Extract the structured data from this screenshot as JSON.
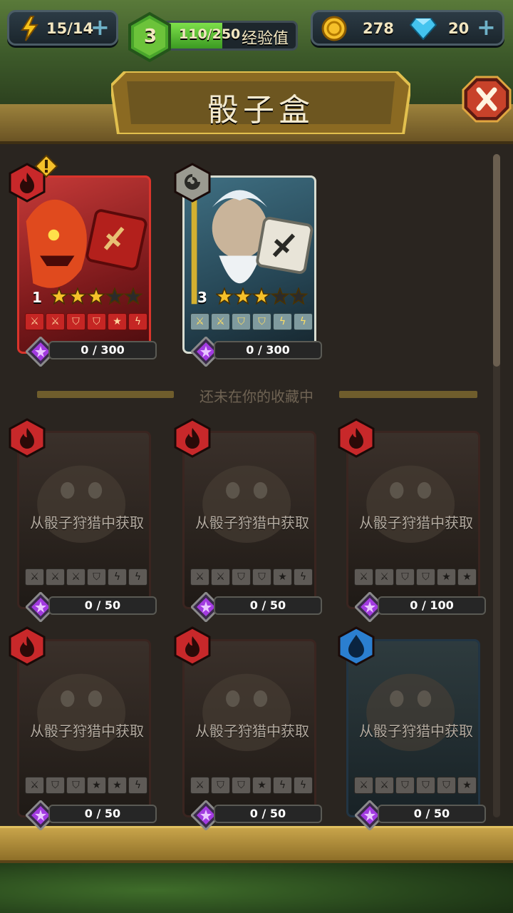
{
  "topbar": {
    "energy": "15/14",
    "level": "3",
    "xp_text": "110/250",
    "xp_label": "经验值",
    "xp_progress": 0.44,
    "coins": "278",
    "gems": "20"
  },
  "dialog": {
    "title": "骰子盒",
    "divider": "还未在你的收藏中"
  },
  "owned": [
    {
      "level": "1",
      "stars": 3,
      "progress": "0 / 300",
      "element": "fire",
      "warning": true,
      "faces": [
        "⚔",
        "⚔",
        "⛉",
        "⛉",
        "★",
        "ϟ"
      ]
    },
    {
      "level": "3",
      "stars": 3,
      "progress": "0 / 300",
      "element": "wind",
      "warning": false,
      "faces": [
        "⚔",
        "⚔",
        "⛉",
        "⛉",
        "ϟ",
        "ϟ"
      ]
    }
  ],
  "locked": [
    {
      "message": "从骰子狩猎中获取",
      "progress": "0 / 50",
      "element": "fire",
      "faces": [
        "⚔",
        "⚔",
        "⚔",
        "⛉",
        "ϟ",
        "ϟ"
      ]
    },
    {
      "message": "从骰子狩猎中获取",
      "progress": "0 / 50",
      "element": "fire",
      "faces": [
        "⚔",
        "⚔",
        "⛉",
        "⛉",
        "★",
        "ϟ"
      ]
    },
    {
      "message": "从骰子狩猎中获取",
      "progress": "0 / 100",
      "element": "fire",
      "faces": [
        "⚔",
        "⚔",
        "⛉",
        "⛉",
        "★",
        "★"
      ]
    },
    {
      "message": "从骰子狩猎中获取",
      "progress": "0 / 50",
      "element": "fire",
      "faces": [
        "⚔",
        "⛉",
        "⛉",
        "★",
        "★",
        "ϟ"
      ]
    },
    {
      "message": "从骰子狩猎中获取",
      "progress": "0 / 50",
      "element": "fire",
      "faces": [
        "⚔",
        "⛉",
        "⛉",
        "★",
        "ϟ",
        "ϟ"
      ]
    },
    {
      "message": "从骰子狩猎中获取",
      "progress": "0 / 50",
      "element": "water",
      "faces": [
        "⚔",
        "⚔",
        "⛉",
        "⛉",
        "⛉",
        "★"
      ]
    }
  ],
  "colors": {
    "fire": "#c8282a",
    "water": "#2b7fd0",
    "wind": "#9a9a90",
    "gem": "#a23be0"
  }
}
